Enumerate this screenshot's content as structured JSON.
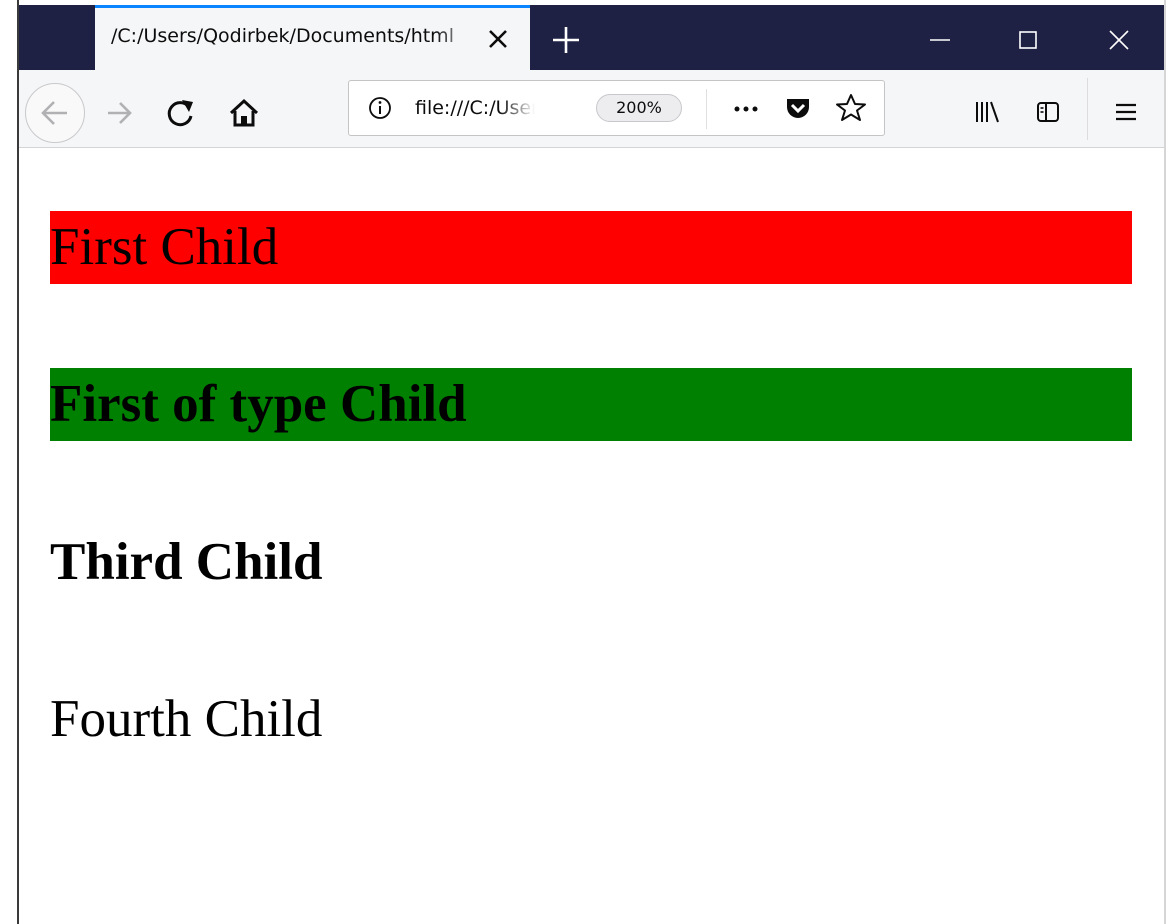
{
  "browser": {
    "tab": {
      "title": "/C:/Users/Qodirbek/Documents/html"
    },
    "url": {
      "text": "file:///C:/Users",
      "zoom": "200%"
    },
    "icons": {
      "back": "back-arrow-icon",
      "forward": "forward-arrow-icon",
      "reload": "reload-icon",
      "home": "home-icon",
      "info": "info-icon",
      "more": "more-actions-icon",
      "pocket": "pocket-icon",
      "bookmark": "star-icon",
      "library": "library-icon",
      "sidebar": "sidebar-icon",
      "menu": "hamburger-menu-icon",
      "new_tab": "plus-icon",
      "close_tab": "close-icon",
      "minimize": "minimize-icon",
      "maximize": "maximize-icon",
      "close_window": "close-window-icon"
    },
    "colors": {
      "titlebar": "#1f2144",
      "tab_accent": "#0a84ff",
      "toolbar": "#f5f6f7"
    }
  },
  "page": {
    "children": [
      {
        "text": "First Child",
        "background": "#ff0000",
        "bold": false
      },
      {
        "text": "First of type Child",
        "background": "#008000",
        "bold": true
      },
      {
        "text": "Third Child",
        "background": "",
        "bold": true
      },
      {
        "text": "Fourth Child",
        "background": "",
        "bold": false
      }
    ]
  }
}
